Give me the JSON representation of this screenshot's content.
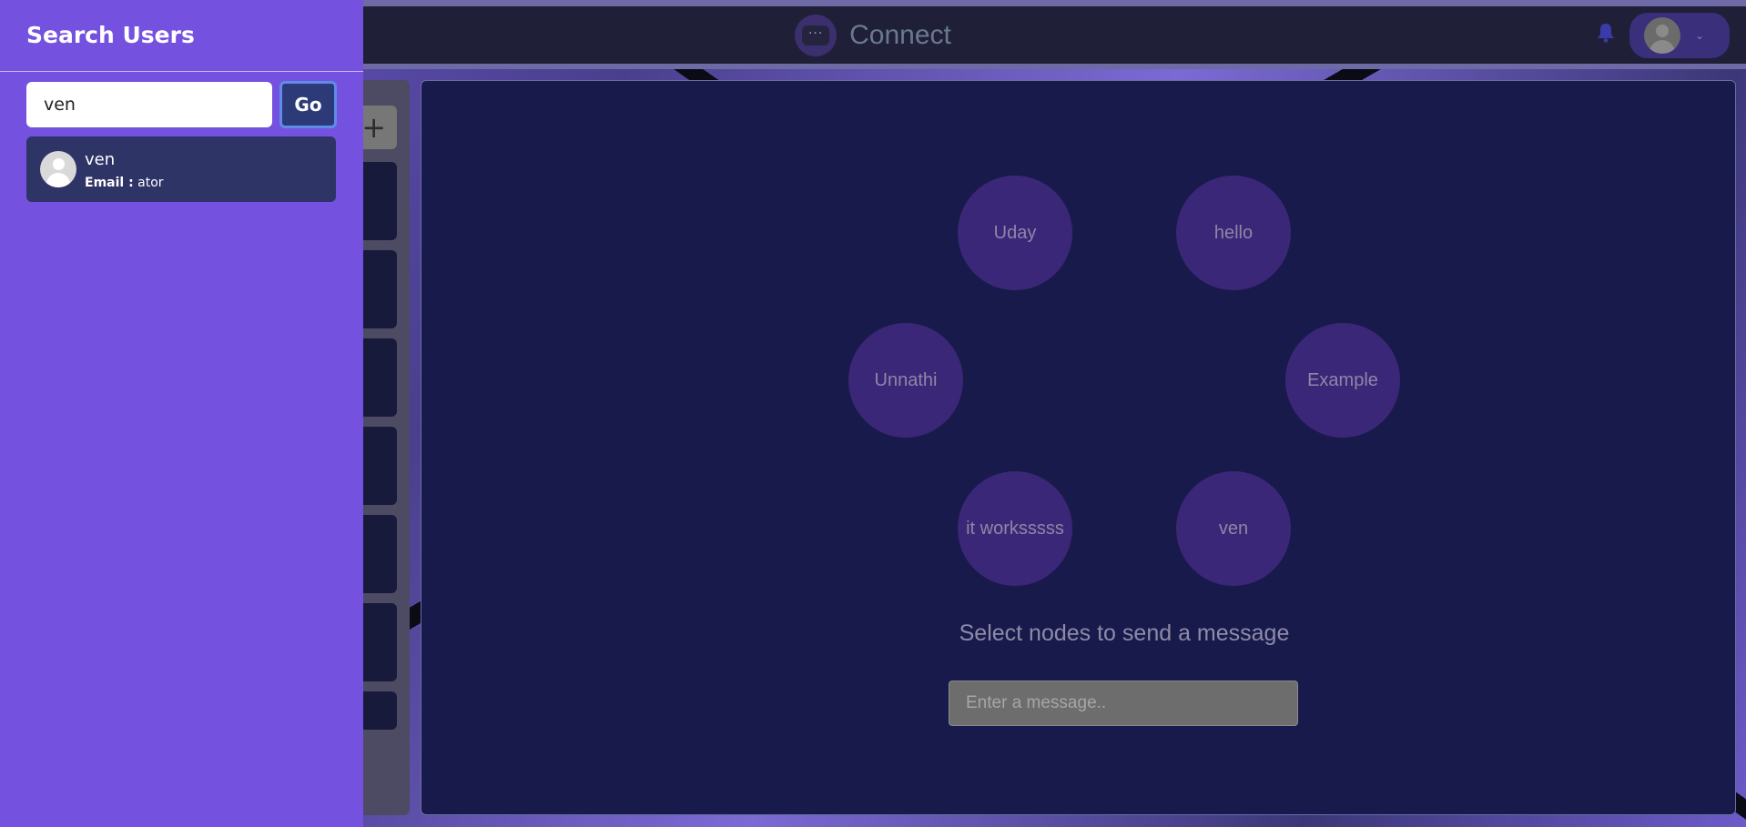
{
  "header": {
    "brand_icon_text": "···",
    "brand_title": "Connect",
    "notification_icon": "bell-icon",
    "profile_menu_icon": "chevron-down-icon"
  },
  "chat_list": {
    "add_label": "+",
    "chat_cards": 7
  },
  "main": {
    "nodes": [
      "Uday",
      "hello",
      "Unnathi",
      "Example",
      "it worksssss",
      "ven"
    ],
    "hint": "Select nodes to send a message",
    "message_placeholder": "Enter a message.."
  },
  "drawer": {
    "title": "Search Users",
    "search_value": "ven",
    "go_label": "Go",
    "results": [
      {
        "name": "ven",
        "email_label": "Email :",
        "email_value": "ator"
      }
    ]
  },
  "colors": {
    "drawer_bg": "#7451de",
    "main_bg": "#191a4c",
    "node_bg": "#3b2778",
    "go_button": "#2c3b78",
    "result_bg": "#2f3466"
  }
}
